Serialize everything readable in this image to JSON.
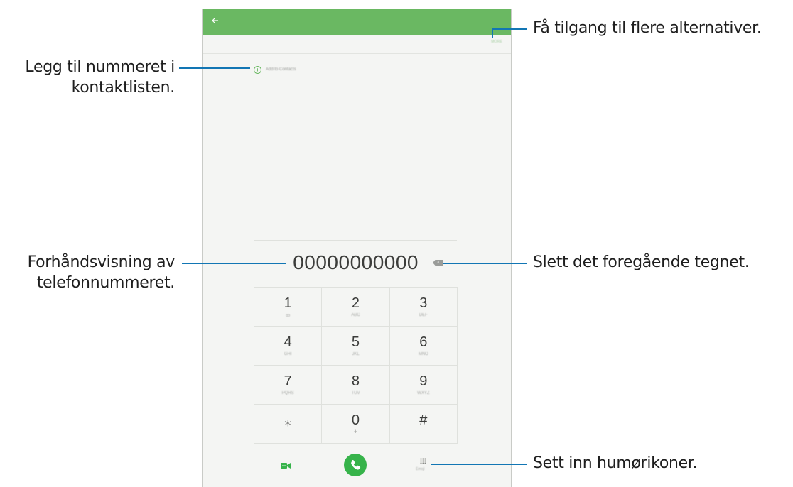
{
  "phone": {
    "add_contacts_label": "Add to Contacts",
    "more_label": "MORE",
    "number": "00000000000",
    "keys": [
      {
        "digit": "1",
        "sub": "ꝏ"
      },
      {
        "digit": "2",
        "sub": "ABC"
      },
      {
        "digit": "3",
        "sub": "DEF"
      },
      {
        "digit": "4",
        "sub": "GHI"
      },
      {
        "digit": "5",
        "sub": "JKL"
      },
      {
        "digit": "6",
        "sub": "MNO"
      },
      {
        "digit": "7",
        "sub": "PQRS"
      },
      {
        "digit": "8",
        "sub": "TUV"
      },
      {
        "digit": "9",
        "sub": "WXYZ"
      },
      {
        "digit": "⁎",
        "sub": ""
      },
      {
        "digit": "0",
        "sub": "+"
      },
      {
        "digit": "#",
        "sub": ""
      }
    ],
    "emoji_label": "Emoji",
    "colors": {
      "appbar": "#6ab862",
      "call": "#36b34a",
      "callout_line": "#1276b4"
    }
  },
  "callouts": {
    "add_line1": "Legg til nummeret i",
    "add_line2": "kontaktlisten.",
    "preview_line1": "Forhåndsvisning av",
    "preview_line2": "telefonnummeret.",
    "more": "Få tilgang til flere alternativer.",
    "delete": "Slett det foregående tegnet.",
    "emoji": "Sett inn humørikoner."
  }
}
